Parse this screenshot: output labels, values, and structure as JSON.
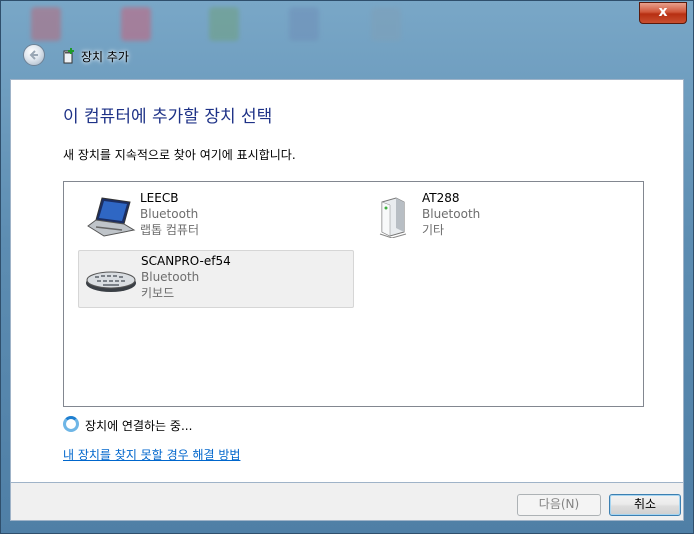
{
  "window": {
    "title": "장치 추가",
    "close_label": "x"
  },
  "main": {
    "heading": "이 컴퓨터에 추가할 장치 선택",
    "subtext": "새 장치를 지속적으로 찾아 여기에 표시합니다."
  },
  "devices": [
    {
      "name": "LEECB",
      "type": "Bluetooth",
      "category": "랩톱 컴퓨터",
      "icon": "laptop-icon",
      "selected": false
    },
    {
      "name": "AT288",
      "type": "Bluetooth",
      "category": "기타",
      "icon": "device-tower-icon",
      "selected": false
    },
    {
      "name": "SCANPRO-ef54",
      "type": "Bluetooth",
      "category": "키보드",
      "icon": "keyboard-icon",
      "selected": true
    }
  ],
  "status": {
    "text": "장치에 연결하는 중..."
  },
  "help_link": "내 장치를 찾지 못할 경우 해결 방법",
  "buttons": {
    "next": "다음(N)",
    "cancel": "취소"
  },
  "colors": {
    "heading": "#1e3287",
    "link": "#0066cc",
    "close_button": "#c94f30"
  }
}
